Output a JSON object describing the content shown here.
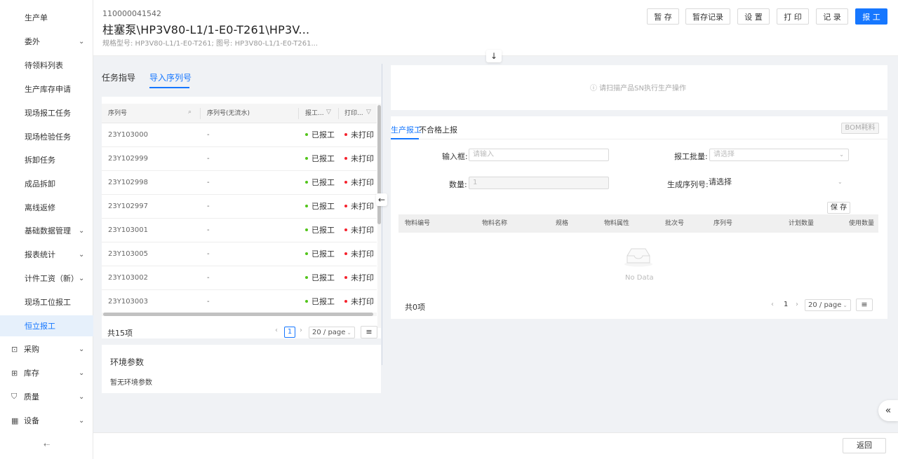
{
  "sidebar": {
    "items": [
      {
        "label": "生产单",
        "chevron": false
      },
      {
        "label": "委外",
        "chevron": true
      },
      {
        "label": "待领料列表",
        "chevron": false
      },
      {
        "label": "生产库存申请",
        "chevron": false
      },
      {
        "label": "现场报工任务",
        "chevron": false
      },
      {
        "label": "现场检验任务",
        "chevron": false
      },
      {
        "label": "拆卸任务",
        "chevron": false
      },
      {
        "label": "成品拆卸",
        "chevron": false
      },
      {
        "label": "离线返修",
        "chevron": false
      },
      {
        "label": "基础数据管理",
        "chevron": true
      },
      {
        "label": "报表统计",
        "chevron": true
      },
      {
        "label": "计件工资（新）",
        "chevron": true
      },
      {
        "label": "现场工位报工",
        "chevron": false
      },
      {
        "label": "恒立报工",
        "chevron": false,
        "active": true
      }
    ],
    "groups": [
      {
        "label": "采购",
        "icon": "bag-icon"
      },
      {
        "label": "库存",
        "icon": "warehouse-icon"
      },
      {
        "label": "质量",
        "icon": "shield-icon"
      },
      {
        "label": "设备",
        "icon": "device-icon"
      }
    ],
    "collapse_glyph": "⇠",
    "chevron_glyph": "⌄"
  },
  "header": {
    "order_no": "110000041542",
    "title": "柱塞泵\\HP3V80-L1/1-E0-T261\\HP3V...",
    "subtitle": "规格型号: HP3V80-L1/1-E0-T261; 图号: HP3V80-L1/1-E0-T261...",
    "buttons": {
      "stash": "暂 存",
      "stash_records": "暂存记录",
      "settings": "设 置",
      "print": "打 印",
      "records": "记 录",
      "report": "报 工"
    },
    "expand_glyph": "↓"
  },
  "left": {
    "tabs": {
      "task_guide": "任务指导",
      "import_serial": "导入序列号"
    },
    "columns": {
      "serial": "序列号",
      "serial_no_flow": "序列号(无流水)",
      "report": "报工...",
      "print": "打印..."
    },
    "rows": [
      {
        "serial": "23Y103000",
        "flow": "-",
        "report": "已报工",
        "print": "未打印"
      },
      {
        "serial": "23Y102999",
        "flow": "-",
        "report": "已报工",
        "print": "未打印"
      },
      {
        "serial": "23Y102998",
        "flow": "-",
        "report": "已报工",
        "print": "未打印"
      },
      {
        "serial": "23Y102997",
        "flow": "-",
        "report": "已报工",
        "print": "未打印"
      },
      {
        "serial": "23Y103001",
        "flow": "-",
        "report": "已报工",
        "print": "未打印"
      },
      {
        "serial": "23Y103005",
        "flow": "-",
        "report": "已报工",
        "print": "未打印"
      },
      {
        "serial": "23Y103002",
        "flow": "-",
        "report": "已报工",
        "print": "未打印"
      },
      {
        "serial": "23Y103003",
        "flow": "-",
        "report": "已报工",
        "print": "未打印"
      }
    ],
    "pager": {
      "total": "共15项",
      "current": "1",
      "page_size": "20 / page",
      "prev": "‹",
      "next": "›",
      "menu": "≡"
    },
    "env": {
      "title": "环境参数",
      "empty": "暂无环境参数"
    },
    "collapse_glyph": "←"
  },
  "right": {
    "scan_hint": "ⓘ 请扫描产品SN执行生产操作",
    "tabs": {
      "production_report": "生产报工",
      "nonconforming": "不合格上报"
    },
    "bom_button": "BOM耗料",
    "form": {
      "input_label": "输入框:",
      "input_placeholder": "请输入",
      "batch_label": "报工批量:",
      "batch_placeholder": "请选择",
      "qty_label": "数量:",
      "qty_value": "1",
      "gen_serial_label": "生成序列号:",
      "gen_serial_value": "请选择"
    },
    "save_button": "保 存",
    "material_columns": [
      "物料编号",
      "物料名称",
      "规格",
      "物料属性",
      "批次号",
      "序列号",
      "计划数量",
      "使用数量"
    ],
    "empty_text": "No Data",
    "pager": {
      "total": "共0项",
      "current": "1",
      "page_size": "20 / page",
      "prev": "‹",
      "next": "›",
      "menu": "≡"
    }
  },
  "floating_glyph": "«",
  "footer": {
    "back": "返回"
  },
  "colors": {
    "primary": "#1677ff",
    "success": "#52c41a",
    "danger": "#f5222d"
  }
}
